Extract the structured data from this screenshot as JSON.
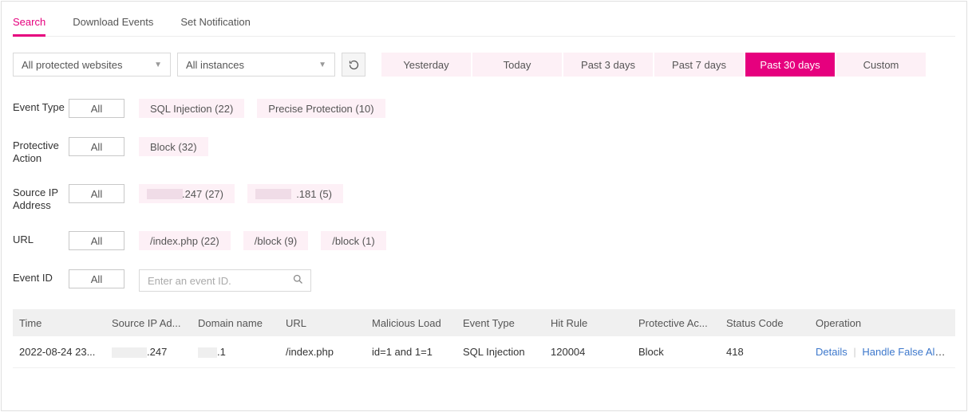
{
  "tabs": {
    "search": "Search",
    "download": "Download Events",
    "notify": "Set Notification"
  },
  "filters": {
    "websites": "All protected websites",
    "instances": "All instances"
  },
  "time_ranges": [
    "Yesterday",
    "Today",
    "Past 3 days",
    "Past 7 days",
    "Past 30 days",
    "Custom"
  ],
  "time_active_index": 4,
  "facets": {
    "event_type": {
      "label": "Event Type",
      "all": "All",
      "chips": [
        "SQL Injection (22)",
        "Precise Protection (10)"
      ]
    },
    "protective_action": {
      "label": "Protective Action",
      "all": "All",
      "chips": [
        "Block (32)"
      ]
    },
    "source_ip": {
      "label": "Source IP Address",
      "all": "All",
      "chips": [
        ".247 (27)",
        ".181 (5)"
      ]
    },
    "url": {
      "label": "URL",
      "all": "All",
      "chips": [
        "/index.php (22)",
        "/block (9)",
        "/block (1)"
      ]
    },
    "event_id": {
      "label": "Event ID",
      "all": "All",
      "placeholder": "Enter an event ID."
    }
  },
  "table": {
    "headers": {
      "time": "Time",
      "src": "Source IP Ad...",
      "domain": "Domain name",
      "url": "URL",
      "load": "Malicious Load",
      "type": "Event Type",
      "rule": "Hit Rule",
      "action": "Protective Ac...",
      "status": "Status Code",
      "op": "Operation"
    },
    "rows": [
      {
        "time": "2022-08-24 23...",
        "src_suffix": ".247",
        "domain_suffix": ".1",
        "url": "/index.php",
        "load": "id=1 and 1=1",
        "type": "SQL Injection",
        "rule": "120004",
        "action": "Block",
        "status": "418",
        "op_details": "Details",
        "op_handle": "Handle False Alarm"
      }
    ]
  }
}
